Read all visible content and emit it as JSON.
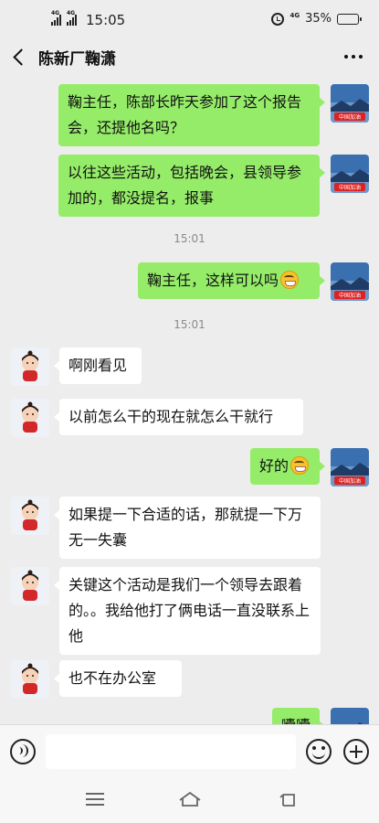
{
  "status_bar": {
    "network_a": "4G",
    "network_b": "4G",
    "time": "15:05",
    "data_network": "4G",
    "battery_percent": "35%",
    "battery_level": 0.35
  },
  "header": {
    "title": "陈新厂鞠潇"
  },
  "messages": [
    {
      "id": "m1",
      "side": "me",
      "text": "鞠主任，陈部长昨天参加了这个报告会，还提他名吗？"
    },
    {
      "id": "m2",
      "side": "me",
      "text": "以往这些活动，包括晚会，县领导参加的，都没提名，报事"
    },
    {
      "id": "t1",
      "type": "time",
      "text": "15:01"
    },
    {
      "id": "m3",
      "side": "me",
      "text": "鞠主任，这样可以吗",
      "emoji": "grin-emoji"
    },
    {
      "id": "t2",
      "type": "time",
      "text": "15:01"
    },
    {
      "id": "m4",
      "side": "other",
      "text": "啊刚看见"
    },
    {
      "id": "m5",
      "side": "other",
      "text": "以前怎么干的现在就怎么干就行"
    },
    {
      "id": "m6",
      "side": "me",
      "text": "好的",
      "emoji": "grin-emoji"
    },
    {
      "id": "m7",
      "side": "other",
      "text": "如果提一下合适的话，那就提一下万无一失囊"
    },
    {
      "id": "m8",
      "side": "other",
      "text": "关键这个活动是我们一个领导去跟着的。。我给他打了俩电话一直没联系上他"
    },
    {
      "id": "m9",
      "side": "other",
      "text": "也不在办公室"
    },
    {
      "id": "m10",
      "side": "me",
      "text": "囔囔"
    }
  ],
  "my_avatar_banner": "中国加油",
  "input": {
    "value": "",
    "placeholder": ""
  },
  "icons": {
    "back": "chevron-left-icon",
    "more": "more-dots-icon",
    "voice": "voice-icon",
    "emoji": "emoji-icon",
    "plus": "plus-icon",
    "nav_menu": "menu-icon",
    "nav_home": "home-icon",
    "nav_back": "back-icon"
  },
  "colors": {
    "my_bubble": "#95ec69",
    "other_bubble": "#ffffff",
    "background": "#ededed"
  }
}
